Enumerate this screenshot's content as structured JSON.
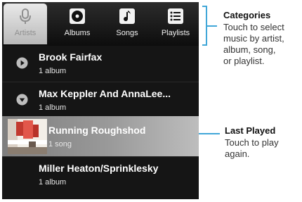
{
  "tabs": [
    {
      "label": "Artists",
      "icon": "microphone-icon",
      "active": true
    },
    {
      "label": "Albums",
      "icon": "album-icon",
      "active": false
    },
    {
      "label": "Songs",
      "icon": "music-note-icon",
      "active": false
    },
    {
      "label": "Playlists",
      "icon": "playlist-icon",
      "active": false
    }
  ],
  "rows": [
    {
      "title": "Brook Fairfax",
      "subtitle": "1 album",
      "expander": "expand-right-icon"
    },
    {
      "title": "Max Keppler And AnnaLee...",
      "subtitle": "1 album",
      "expander": "expand-down-icon"
    },
    {
      "title": "Running Roughshod",
      "subtitle": "1 song",
      "thumbnail": "album-art-thumbnail",
      "selected": true
    },
    {
      "title": "Miller Heaton/Sprinklesky",
      "subtitle": "1 album"
    }
  ],
  "callouts": {
    "categories": {
      "title": "Categories",
      "text": [
        "Touch to select",
        "music by artist,",
        "album, song,",
        "or playlist."
      ]
    },
    "last_played": {
      "title": "Last Played",
      "text": [
        "Touch to play",
        "again."
      ]
    }
  },
  "colors": {
    "accent_line": "#41a7d8",
    "screen_bg": "#151515"
  }
}
